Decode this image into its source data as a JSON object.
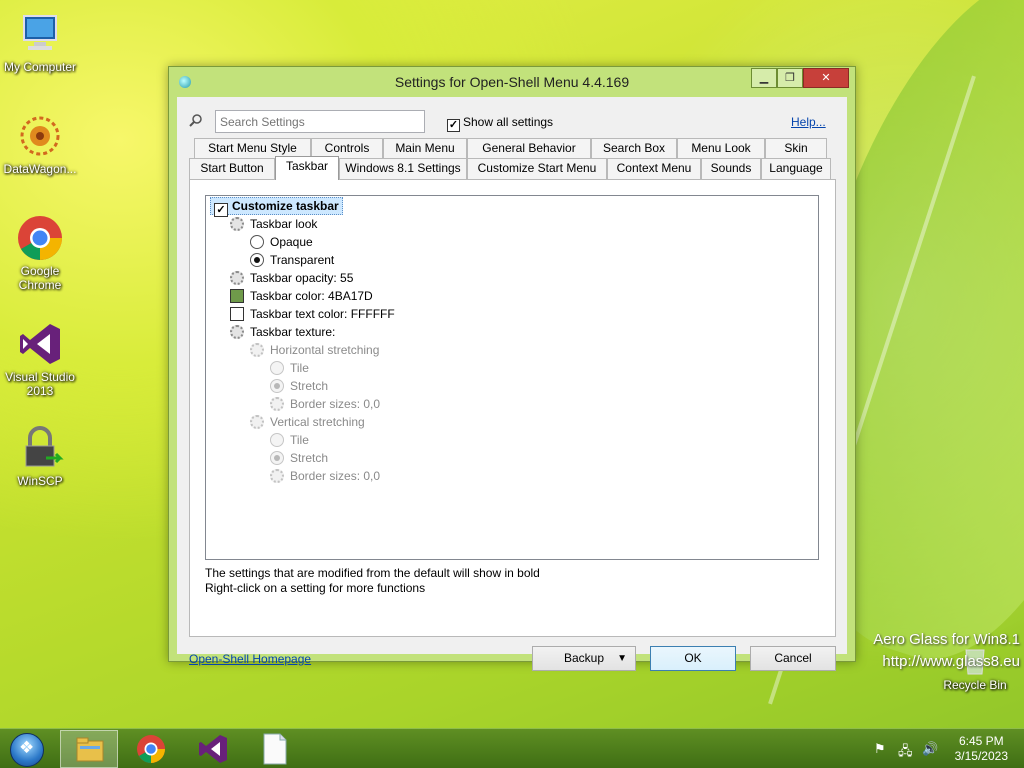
{
  "desktop": {
    "icons": [
      {
        "name": "my-computer",
        "label": "My Computer"
      },
      {
        "name": "datawagon",
        "label": "DataWagon..."
      },
      {
        "name": "google-chrome",
        "label": "Google Chrome"
      },
      {
        "name": "visual-studio",
        "label": "Visual Studio 2013"
      },
      {
        "name": "winscp",
        "label": "WinSCP"
      },
      {
        "name": "recycle-bin",
        "label": "Recycle Bin"
      }
    ],
    "watermark_line1": "Aero Glass for Win8.1",
    "watermark_line2": "http://www.glass8.eu"
  },
  "dialog": {
    "title": "Settings for Open-Shell Menu 4.4.169",
    "search": {
      "placeholder": "Search Settings"
    },
    "show_all_label": "Show all settings",
    "show_all_checked": true,
    "help_label": "Help...",
    "tabs_row1": [
      "Start Menu Style",
      "Controls",
      "Main Menu",
      "General Behavior",
      "Search Box",
      "Menu Look",
      "Skin"
    ],
    "tabs_row2": [
      "Start Button",
      "Taskbar",
      "Windows 8.1 Settings",
      "Customize Start Menu",
      "Context Menu",
      "Sounds",
      "Language"
    ],
    "active_tab": "Taskbar",
    "tree": {
      "customize": "Customize taskbar",
      "look": "Taskbar look",
      "opaque": "Opaque",
      "transparent": "Transparent",
      "opacity": "Taskbar opacity: 55",
      "color": "Taskbar color: 4BA17D",
      "color_hex": "#6f9a4a",
      "text_color": "Taskbar text color: FFFFFF",
      "texture": "Taskbar texture:",
      "h_stretch": "Horizontal stretching",
      "h_tile": "Tile",
      "h_stretch_opt": "Stretch",
      "h_border": "Border sizes: 0,0",
      "v_stretch": "Vertical stretching",
      "v_tile": "Tile",
      "v_stretch_opt": "Stretch",
      "v_border": "Border sizes: 0,0"
    },
    "note1": "The settings that are modified from the default will show in bold",
    "note2": "Right-click on a setting for more functions",
    "homepage_label": "Open-Shell Homepage",
    "backup_label": "Backup",
    "ok_label": "OK",
    "cancel_label": "Cancel"
  },
  "taskbar": {
    "time": "6:45 PM",
    "date": "3/15/2023"
  }
}
